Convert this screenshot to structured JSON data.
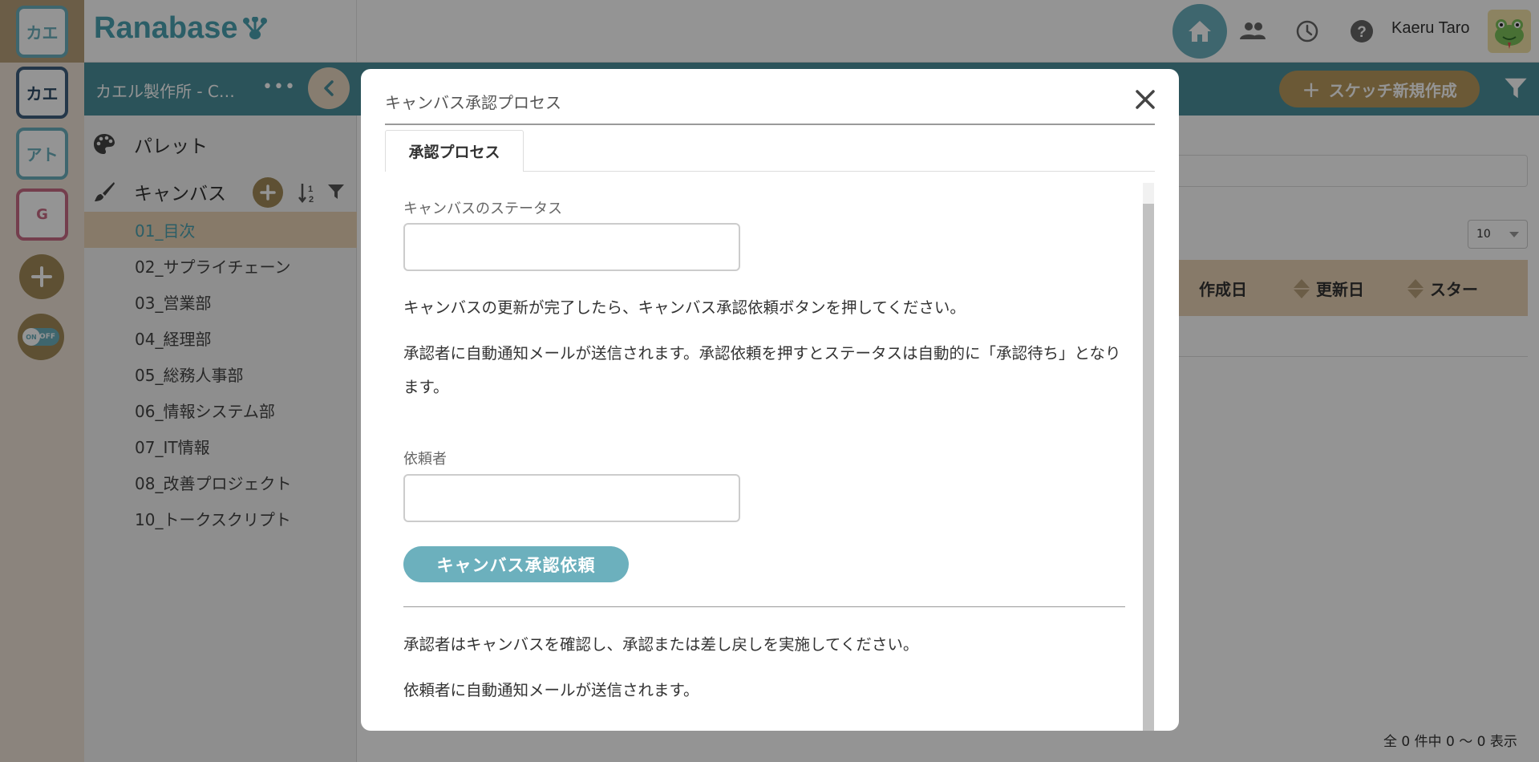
{
  "colors": {
    "brand_teal": "#4aa3b2",
    "accent_teal": "#6cb0bd",
    "dark_teal_bar": "#4a8f9c",
    "gold": "#a28b58",
    "beige_rail": "#efe4d7",
    "selected_row": "#e9d2b5"
  },
  "rail": {
    "workspaces": [
      {
        "label": "カエ"
      },
      {
        "label": "カエ"
      },
      {
        "label": "アト"
      },
      {
        "label": "G"
      }
    ],
    "add_icon": "plus-icon",
    "toggle": {
      "on": "ON",
      "off": "OFF"
    }
  },
  "header": {
    "logo_text": "Ranabase",
    "user_name": "Kaeru Taro",
    "icons": [
      "home-icon",
      "users-icon",
      "history-icon",
      "help-icon"
    ]
  },
  "sidebar": {
    "project_name": "カエル製作所 - C…",
    "more": "•••",
    "palette_label": "パレット",
    "canvas_label": "キャンバス",
    "canvases": [
      {
        "label": "01_目次",
        "active": true
      },
      {
        "label": "02_サプライチェーン"
      },
      {
        "label": "03_営業部"
      },
      {
        "label": "04_経理部"
      },
      {
        "label": "05_総務人事部"
      },
      {
        "label": "06_情報システム部"
      },
      {
        "label": "07_IT情報"
      },
      {
        "label": "08_改善プロジェクト"
      },
      {
        "label": "10_トークスクリプト"
      }
    ]
  },
  "main": {
    "new_sketch_label": "スケッチ新規作成",
    "page_size": "10",
    "columns": [
      "作成日",
      "更新日",
      "スター"
    ],
    "summary": "全 0 件中 0 〜 0 表示"
  },
  "modal": {
    "title": "キャンバス承認プロセス",
    "tab_label": "承認プロセス",
    "status_label": "キャンバスのステータス",
    "status_value": "",
    "instruction_1": "キャンバスの更新が完了したら、キャンバス承認依頼ボタンを押してください。",
    "instruction_2": "承認者に自動通知メールが送信されます。承認依頼を押すとステータスは自動的に「承認待ち」となります。",
    "requester_label": "依頼者",
    "requester_value": "",
    "request_button": "キャンバス承認依頼",
    "approver_note": "承認者はキャンバスを確認し、承認または差し戻しを実施してください。",
    "notify_note": "依頼者に自動通知メールが送信されます。"
  }
}
